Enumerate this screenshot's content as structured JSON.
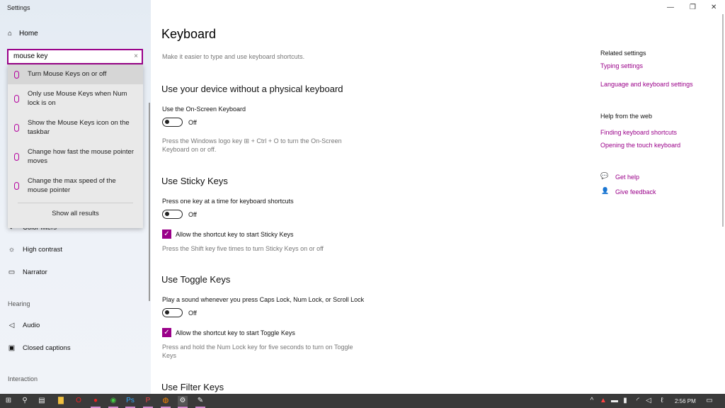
{
  "window": {
    "title": "Settings",
    "minimize": "—",
    "restore": "❐",
    "close": "✕"
  },
  "sidebar": {
    "home": "Home",
    "search_value": "mouse key",
    "clear": "×",
    "suggestions": [
      "Turn Mouse Keys on or off",
      "Only use Mouse Keys when Num lock is on",
      "Show the Mouse Keys icon on the taskbar",
      "Change how fast the mouse pointer moves",
      "Change the max speed of the mouse pointer"
    ],
    "show_all": "Show all results",
    "items": [
      {
        "label": "Color filters"
      },
      {
        "label": "High contrast"
      },
      {
        "label": "Narrator"
      }
    ],
    "hearing": "Hearing",
    "hearing_items": [
      {
        "label": "Audio"
      },
      {
        "label": "Closed captions"
      }
    ],
    "interaction": "Interaction"
  },
  "main": {
    "title": "Keyboard",
    "subtitle": "Make it easier to type and use keyboard shortcuts.",
    "osk": {
      "heading": "Use your device without a physical keyboard",
      "label": "Use the On-Screen Keyboard",
      "state": "Off",
      "desc": "Press the Windows logo key ⊞ + Ctrl + O to turn the On-Screen Keyboard on or off."
    },
    "sticky": {
      "heading": "Use Sticky Keys",
      "label": "Press one key at a time for keyboard shortcuts",
      "state": "Off",
      "checkbox": "Allow the shortcut key to start Sticky Keys",
      "checked": true,
      "desc": "Press the Shift key five times to turn Sticky Keys on or off"
    },
    "toggle": {
      "heading": "Use Toggle Keys",
      "label": "Play a sound whenever you press Caps Lock, Num Lock, or Scroll Lock",
      "state": "Off",
      "checkbox": "Allow the shortcut key to start Toggle Keys",
      "checked": true,
      "desc": "Press and hold the Num Lock key for five seconds to turn on Toggle Keys"
    },
    "filter": {
      "heading": "Use Filter Keys"
    }
  },
  "related": {
    "heading": "Related settings",
    "links": [
      "Typing settings",
      "Language and keyboard settings"
    ],
    "web_heading": "Help from the web",
    "web_links": [
      "Finding keyboard shortcuts",
      "Opening the touch keyboard"
    ],
    "get_help": "Get help",
    "feedback": "Give feedback"
  },
  "taskbar": {
    "time": "2:56 PM"
  },
  "colors": {
    "accent": "#9a0089"
  }
}
